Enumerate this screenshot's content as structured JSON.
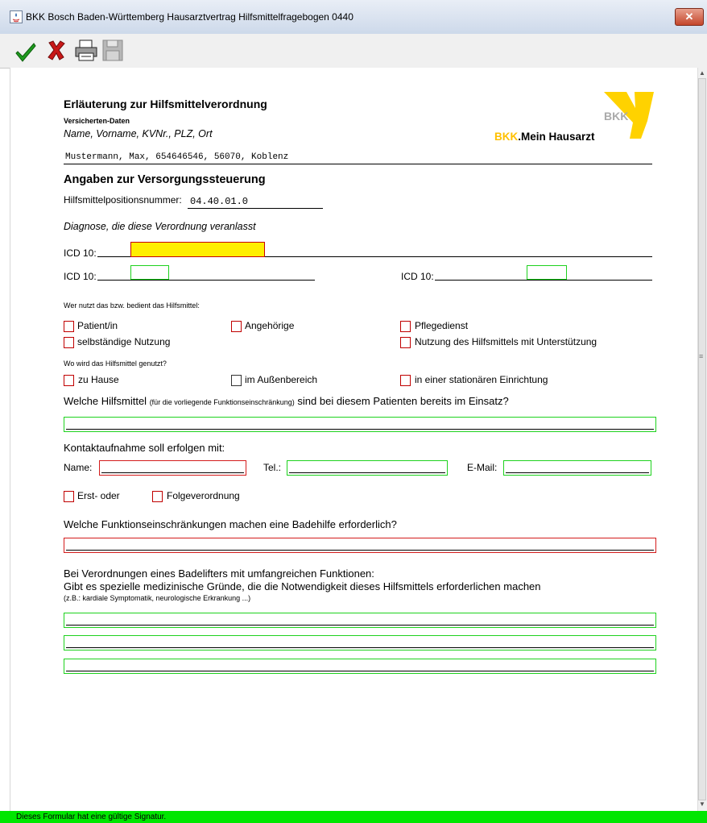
{
  "window": {
    "title": "BKK Bosch Baden-Württemberg Hausarztvertrag Hilfsmittelfragebogen 0440",
    "close_glyph": "✕"
  },
  "toolbar": {
    "ok_icon": "checkmark-icon",
    "cancel_icon": "x-icon",
    "print_icon": "printer-icon",
    "save_icon": "disk-icon"
  },
  "logo": {
    "bkk": "BKK",
    "brand_prefix": "BKK",
    "brand_suffix": ".Mein Hausarzt",
    "yellow": "#ffd200"
  },
  "form": {
    "title": "Erläuterung zur Hilfsmittelverordnung",
    "insured_label": "Versicherten-Daten",
    "insured_sub": "Name, Vorname, KVNr., PLZ, Ort",
    "insured_value": "Mustermann, Max, 654646546, 56070, Koblenz",
    "section_title": "Angaben zur Versorgungssteuerung",
    "position_label": "Hilfsmittelpositionsnummer:",
    "position_value": "04.40.01.0",
    "diagnosis_label": "Diagnose, die diese Verordnung veranlasst",
    "icd_label": "ICD 10:",
    "who_label": "Wer nutzt das bzw. bedient das Hilfsmittel:",
    "who_options": {
      "patient": "Patient/in",
      "relatives": "Angehörige",
      "nursing": "Pflegedienst",
      "independent": "selbständige Nutzung",
      "supported": "Nutzung des Hilfsmittels mit Unterstützung"
    },
    "where_label": "Wo wird das Hilfsmittel genutzt?",
    "where_options": {
      "home": "zu Hause",
      "outdoor": "im Außenbereich",
      "inpatient": "in einer stationären Einrichtung"
    },
    "aids_q_part1": "Welche Hilfsmittel ",
    "aids_q_part2": "(für die vorliegende Funktionseinschränkung)",
    "aids_q_part3": " sind bei diesem Patienten bereits im Einsatz?",
    "contact_label": "Kontaktaufnahme soll erfolgen mit:",
    "name_label": "Name:",
    "tel_label": "Tel.:",
    "email_label": "E-Mail:",
    "first_prescription": "Erst- oder",
    "follow_prescription": "Folgeverordnung",
    "function_q": "Welche Funktionseinschränkungen machen eine Badehilfe erforderlich?",
    "lifter_q1": "Bei Verordnungen eines Badelifters mit umfangreichen Funktionen:",
    "lifter_q2": "Gibt es spezielle medizinische Gründe, die die Notwendigkeit dieses Hilfsmittels erforderlichen machen",
    "lifter_q3": "(z.B.: kardiale Symptomatik, neurologische Erkrankung ...)"
  },
  "status": {
    "text": "Dieses Formular hat eine gültige Signatur.",
    "color": "#00e600"
  },
  "colors": {
    "required_border": "#d41c1c",
    "optional_border": "#1ed21e",
    "focus_fill": "#ffee00"
  }
}
